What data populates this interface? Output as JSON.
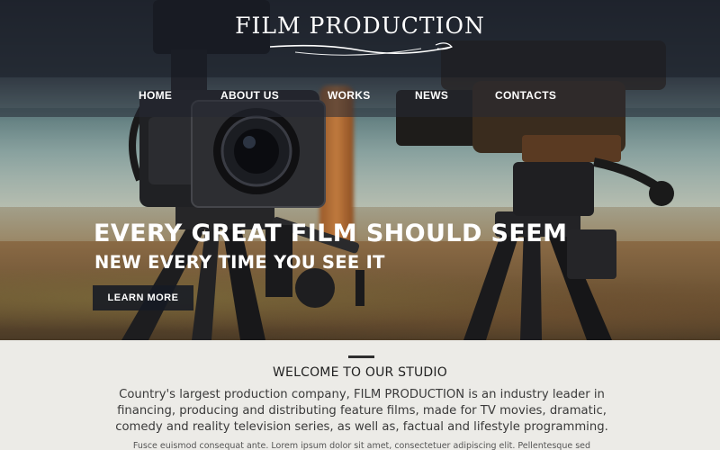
{
  "header": {
    "logo_text": "FILM PRODUCTION"
  },
  "nav": {
    "items": [
      "HOME",
      "ABOUT US",
      "WORKS",
      "NEWS",
      "CONTACTS"
    ]
  },
  "hero": {
    "headline_line1": "EVERY GREAT FILM SHOULD SEEM",
    "headline_line2": "NEW EVERY TIME YOU SEE IT",
    "cta_label": "LEARN MORE"
  },
  "content": {
    "welcome_title": "WELCOME TO OUR STUDIO",
    "intro_line1": "Country's largest production company, FILM PRODUCTION is an industry leader in",
    "intro_line2": "financing, producing and distributing feature films, made for TV movies, dramatic,",
    "intro_line3": "comedy and reality television series, as well as, factual and lifestyle programming.",
    "small_text": "Fusce euismod consequat ante. Lorem ipsum dolor sit amet, consectetuer adipiscing elit. Pellentesque sed"
  },
  "colors": {
    "header_overlay": "#1a1e28",
    "cta_background": "#161a24",
    "content_background": "#ecebe7",
    "text_dark": "#222222"
  },
  "icons": [
    "logo-swash-ornament"
  ]
}
